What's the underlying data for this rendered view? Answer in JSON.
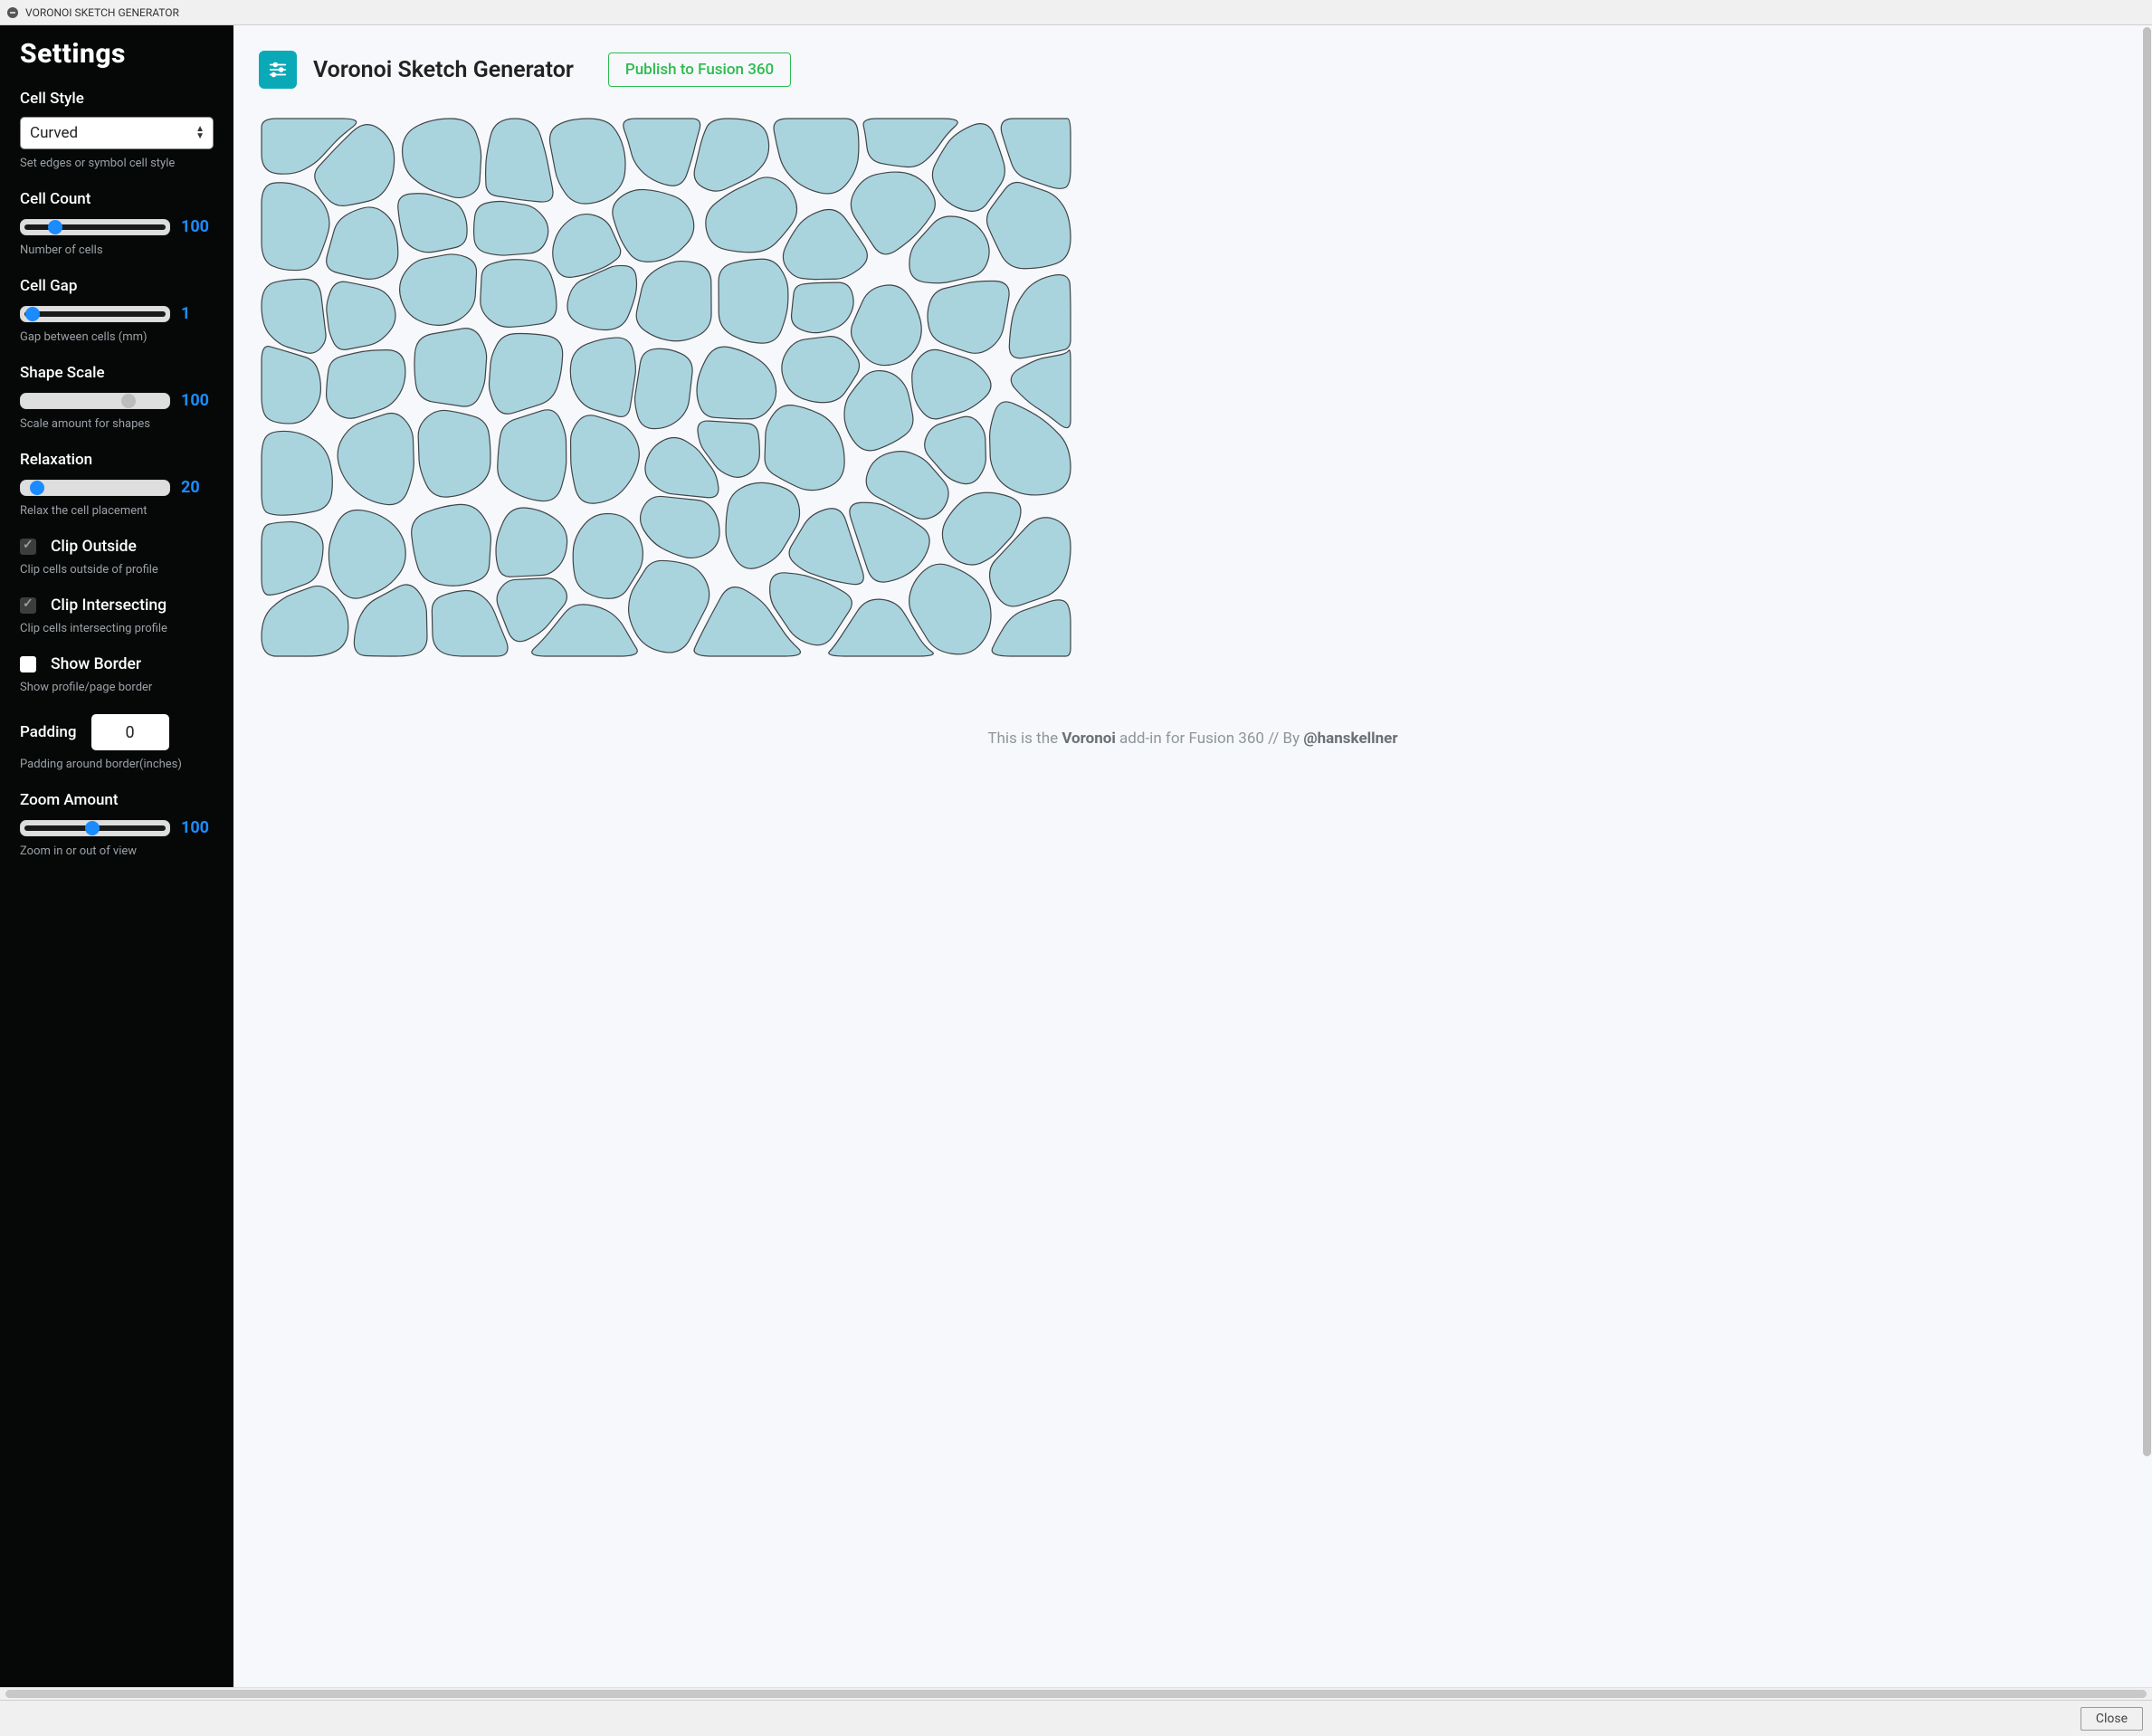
{
  "window": {
    "title": "VORONOI SKETCH GENERATOR"
  },
  "sidebar": {
    "title": "Settings",
    "cell_style": {
      "label": "Cell Style",
      "value": "Curved",
      "help": "Set edges or symbol cell style"
    },
    "cell_count": {
      "label": "Cell Count",
      "value": "100",
      "help": "Number of cells",
      "thumb_pct": 22,
      "track": "dark"
    },
    "cell_gap": {
      "label": "Cell Gap",
      "value": "1",
      "help": "Gap between cells (mm)",
      "thumb_pct": 6,
      "track": "dark"
    },
    "shape_scale": {
      "label": "Shape Scale",
      "value": "100",
      "help": "Scale amount for shapes",
      "thumb_pct": 74,
      "track": "light",
      "thumb": "gray"
    },
    "relaxation": {
      "label": "Relaxation",
      "value": "20",
      "help": "Relax the cell placement",
      "thumb_pct": 9,
      "track": "light"
    },
    "clip_outside": {
      "label": "Clip Outside",
      "help": "Clip cells outside of profile",
      "checked": true
    },
    "clip_intersect": {
      "label": "Clip Intersecting",
      "help": "Clip cells intersecting profile",
      "checked": true
    },
    "show_border": {
      "label": "Show Border",
      "help": "Show profile/page border",
      "checked": false
    },
    "padding": {
      "label": "Padding",
      "value": "0",
      "help": "Padding around border(inches)"
    },
    "zoom": {
      "label": "Zoom Amount",
      "value": "100",
      "help": "Zoom in or out of view",
      "thumb_pct": 48,
      "track": "dark"
    }
  },
  "main": {
    "title": "Voronoi Sketch Generator",
    "publish_label": "Publish to Fusion 360",
    "footer_pre": "This is the ",
    "footer_b1": "Voronoi",
    "footer_mid": " add-in for Fusion 360 // By ",
    "footer_b2": "@hanskellner"
  },
  "bottom": {
    "close_label": "Close"
  }
}
